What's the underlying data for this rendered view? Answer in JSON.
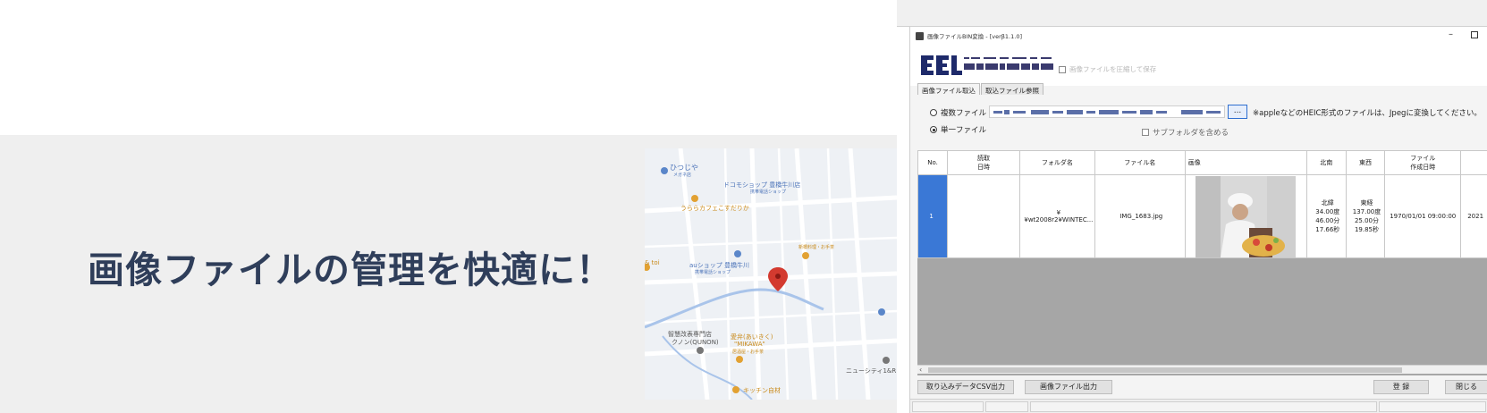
{
  "banner": {
    "headline": "画像ファイルの管理を快適に！",
    "map_labels": {
      "hitsujiya": "ひつじや",
      "hitsujiya_sub": "メガネ店",
      "docomo": "ドコモショップ 豊橋牛川店",
      "docomo_sub": "携帯電話ショップ",
      "urara": "うららカフェこすだりか",
      "au": "auショップ 豊橋牛川",
      "au_sub": "携帯電話ショップ",
      "tenpura": "新橋料理・お手茶",
      "toi": "& toi",
      "quncon": "智慧改表専門店",
      "quncon2": "クノン(QUNON)",
      "mikawa": "愛弁(あいきく)",
      "mikawa2": "\"MIKAWA\"",
      "mikawa3": "居酒屋・お手茶",
      "newcity": "ニューシティ1&R",
      "kitchen": "キッチン自材"
    }
  },
  "app": {
    "title": "画像ファイルBIN変換 - [verβ1.1.0]",
    "min_label": "–",
    "logo_text": "EL",
    "compress_label": "画像ファイルを圧縮して保存",
    "tabs": [
      "画像ファイル取込",
      "取込ファイル参照"
    ],
    "radio_multi": "複数ファイル",
    "radio_single": "単一ファイル",
    "browse_label": "...",
    "note": "※appleなどのHEIC形式のファイルは、Jpegに変換してください。",
    "subfolder_label": "サブフォルダを含める",
    "columns": {
      "no": "No.",
      "import_date": [
        "読取",
        "日時"
      ],
      "folder": "フォルダ名",
      "file": "ファイル名",
      "image": "画像",
      "ns": "北南",
      "ew": "東西",
      "created": [
        "ファイル",
        "作成日時"
      ]
    },
    "row": {
      "no": "1",
      "folder": "¥¥wt2008r2¥WINTEC...",
      "file": "IMG_1683.jpg",
      "ns": [
        "北緯",
        "34.00度",
        "46.00分",
        "17.66秒"
      ],
      "ew": [
        "東経",
        "137.00度",
        "25.00分",
        "19.85秒"
      ],
      "created": "1970/01/01 09:00:00",
      "extra": "2021"
    },
    "buttons": {
      "csv": "取り込みデータCSV出力",
      "image_out": "画像ファイル出力",
      "register": "登 録",
      "close": "閉じる"
    }
  }
}
